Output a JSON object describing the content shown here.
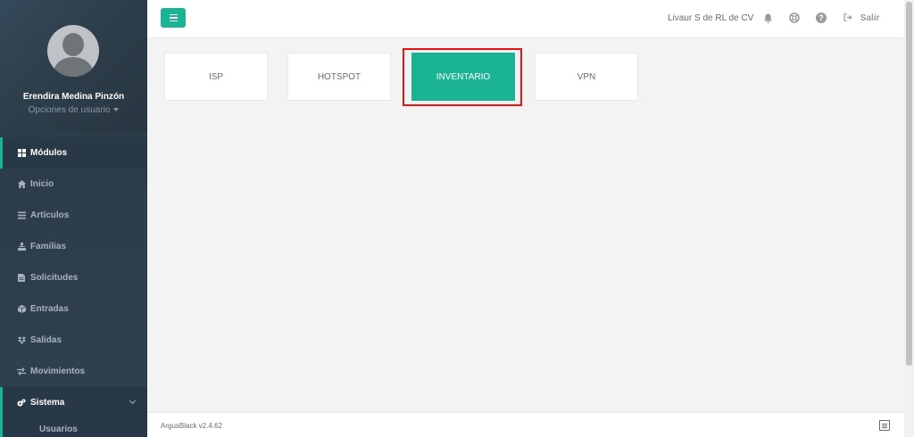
{
  "sidebar": {
    "user_name": "Erendira Medina Pinzón",
    "user_options": "Opciones de usuario",
    "items": [
      {
        "label": "Módulos",
        "icon": "grid-icon"
      },
      {
        "label": "Inicio",
        "icon": "home-icon"
      },
      {
        "label": "Artículos",
        "icon": "list-icon"
      },
      {
        "label": "Familias",
        "icon": "sitemap-icon"
      },
      {
        "label": "Solicitudes",
        "icon": "file-icon"
      },
      {
        "label": "Entradas",
        "icon": "box-icon"
      },
      {
        "label": "Salidas",
        "icon": "dropbox-icon"
      },
      {
        "label": "Movimientos",
        "icon": "exchange-icon"
      },
      {
        "label": "Sistema",
        "icon": "cogs-icon"
      }
    ],
    "sub_items": [
      {
        "label": "Usuarios"
      }
    ]
  },
  "header": {
    "company": "Livaur S de RL de CV",
    "logout_label": "Salir"
  },
  "modules": [
    {
      "label": "ISP"
    },
    {
      "label": "HOTSPOT"
    },
    {
      "label": "INVENTARIO"
    },
    {
      "label": "VPN"
    }
  ],
  "footer": {
    "version": "ArgusBlack v2.4.62"
  },
  "colors": {
    "accent": "#1ab394",
    "sidebar": "#2f4050",
    "highlight": "#ee1111"
  }
}
